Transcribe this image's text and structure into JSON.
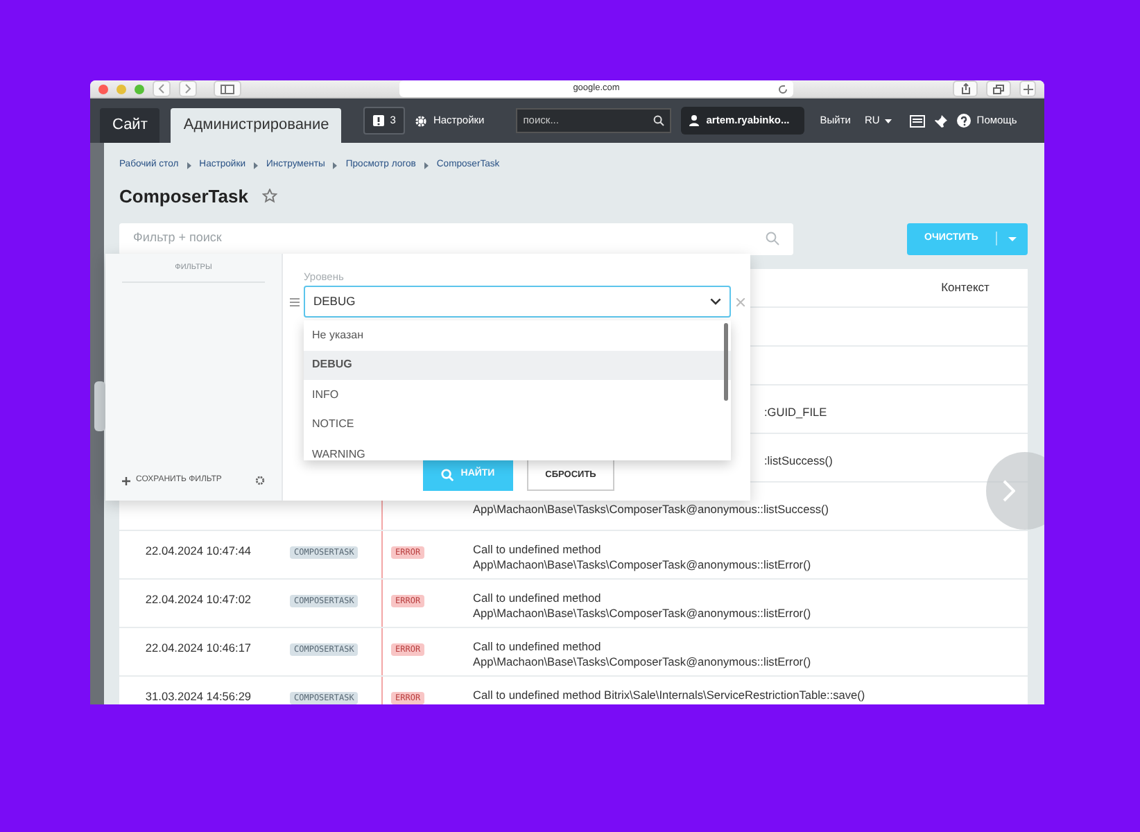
{
  "browser": {
    "url": "google.com"
  },
  "header": {
    "tabs": [
      {
        "label": "Сайт",
        "selected": false
      },
      {
        "label": "Администрирование",
        "selected": true
      }
    ],
    "notifications": "3",
    "settings": "Настройки",
    "search_placeholder": "поиск...",
    "user": "artem.ryabinko...",
    "logout": "Выйти",
    "language": "RU",
    "help": "Помощь"
  },
  "breadcrumbs": [
    "Рабочий стол",
    "Настройки",
    "Инструменты",
    "Просмотр логов",
    "ComposerTask"
  ],
  "title": "ComposerTask",
  "favorite": false,
  "filter": {
    "placeholder": "Фильтр + поиск"
  },
  "clear_button": "ОЧИСТИТЬ",
  "filter_popup": {
    "sidebar_title": "ФИЛЬТРЫ",
    "save_filter": "СОХРАНИТЬ ФИЛЬТР",
    "field_label": "Уровень",
    "field_value": "DEBUG",
    "options": [
      {
        "label": "Не указан",
        "selected": false
      },
      {
        "label": "DEBUG",
        "selected": true
      },
      {
        "label": "INFO",
        "selected": false
      },
      {
        "label": "NOTICE",
        "selected": false
      },
      {
        "label": "WARNING",
        "selected": false
      }
    ],
    "find_button": "НАЙТИ",
    "reset_button": "СБРОСИТЬ"
  },
  "table": {
    "columns": [
      "Контекст"
    ],
    "rows": [
      {
        "kind": "blank"
      },
      {
        "kind": "blank"
      },
      {
        "kind": "tail",
        "message": ":GUID_FILE"
      },
      {
        "kind": "tail",
        "message": ":listSuccess()"
      },
      {
        "kind": "second_line",
        "message": "App\\Machaon\\Base\\Tasks\\ComposerTask@anonymous::listSuccess()"
      },
      {
        "kind": "full",
        "date": "22.04.2024 10:47:44",
        "tag": "COMPOSERTASK",
        "level": "ERROR",
        "message": "Call to undefined method App\\Machaon\\Base\\Tasks\\ComposerTask@anonymous::listError()"
      },
      {
        "kind": "full",
        "date": "22.04.2024 10:47:02",
        "tag": "COMPOSERTASK",
        "level": "ERROR",
        "message": "Call to undefined method App\\Machaon\\Base\\Tasks\\ComposerTask@anonymous::listError()"
      },
      {
        "kind": "full",
        "date": "22.04.2024 10:46:17",
        "tag": "COMPOSERTASK",
        "level": "ERROR",
        "message": "Call to undefined method App\\Machaon\\Base\\Tasks\\ComposerTask@anonymous::listError()"
      },
      {
        "kind": "full",
        "date": "31.03.2024 14:56:29",
        "tag": "COMPOSERTASK",
        "level": "ERROR",
        "message": "Call to undefined method Bitrix\\Sale\\Internals\\ServiceRestrictionTable::save()"
      }
    ]
  }
}
